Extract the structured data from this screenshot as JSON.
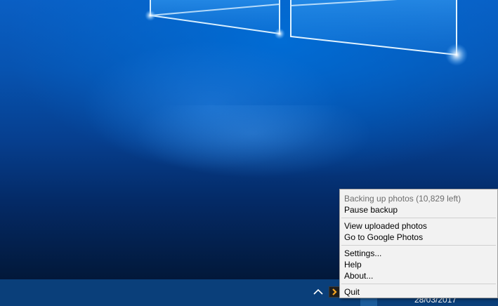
{
  "menu": {
    "status": "Backing up photos (10,829 left)",
    "pause": "Pause backup",
    "view_uploaded": "View uploaded photos",
    "go_to_google_photos": "Go to Google Photos",
    "settings": "Settings...",
    "help": "Help",
    "about": "About...",
    "quit": "Quit"
  },
  "taskbar": {
    "date": "28/03/2017",
    "tray_overflow_icon": "chevron-up-icon",
    "tray_app_icon": "google-photos-backup-icon",
    "accent_color": "#0a3f7a"
  },
  "colors": {
    "wallpaper_top": "#0a5fc4",
    "wallpaper_bottom": "#021839",
    "menu_background": "#f2f2f2",
    "menu_disabled_text": "#6d6d6d"
  }
}
